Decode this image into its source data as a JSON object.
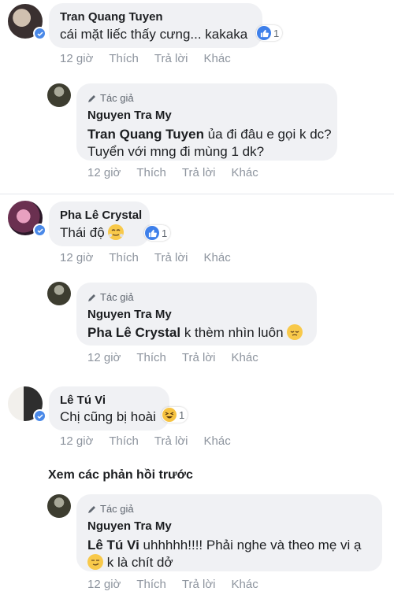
{
  "comments": [
    {
      "name": "Tran Quang Tuyen",
      "text": "cái mặt liếc thấy cưng... kakaka",
      "reaction_count": "1",
      "time": "12 giờ",
      "like": "Thích",
      "reply": "Trả lời",
      "more": "Khác",
      "avatar_colors": [
        "#3a3030",
        "#c9b8a8"
      ],
      "reply_item": {
        "author_badge": "Tác giả",
        "name": "Nguyen Tra My",
        "tagged": "Tran Quang Tuyen",
        "text": " ủa đi đâu e gọi k dc? Tuyển với mng đi mùng 1 dk?",
        "time": "12 giờ",
        "like": "Thích",
        "reply": "Trả lời",
        "more": "Khác"
      }
    },
    {
      "name": "Pha Lê Crystal",
      "text": "Thái độ",
      "reaction_count": "1",
      "time": "12 giờ",
      "like": "Thích",
      "reply": "Trả lời",
      "more": "Khác",
      "avatar_colors": [
        "#5a2a4a",
        "#d98aa8"
      ],
      "reply_item": {
        "author_badge": "Tác giả",
        "name": "Nguyen Tra My",
        "tagged": "Pha Lê Crystal",
        "text": " k thèm nhìn luôn",
        "time": "12 giờ",
        "like": "Thích",
        "reply": "Trả lời",
        "more": "Khác"
      }
    },
    {
      "name": "Lê Tú Vi",
      "text": "Chị cũng bị hoài",
      "reaction_count": "1",
      "time": "12 giờ",
      "like": "Thích",
      "reply": "Trả lời",
      "more": "Khác",
      "avatar_colors": [
        "#e8e6e2",
        "#2b2b2b"
      ]
    }
  ],
  "view_previous": "Xem các phản hồi trước",
  "last_reply": {
    "author_badge": "Tác giả",
    "name": "Nguyen Tra My",
    "tagged": "Lê Tú Vi",
    "text_line1": " uhhhhh!!!! Phải nghe và theo mẹ vi ạ",
    "text_line2": " k là chít dở",
    "time": "12 giờ",
    "like": "Thích",
    "reply": "Trả lời",
    "more": "Khác"
  },
  "colors": {
    "bubble": "#f0f1f4",
    "meta": "#8d949e",
    "like_blue": "#3f80ea",
    "verified": "#4a89e8"
  }
}
